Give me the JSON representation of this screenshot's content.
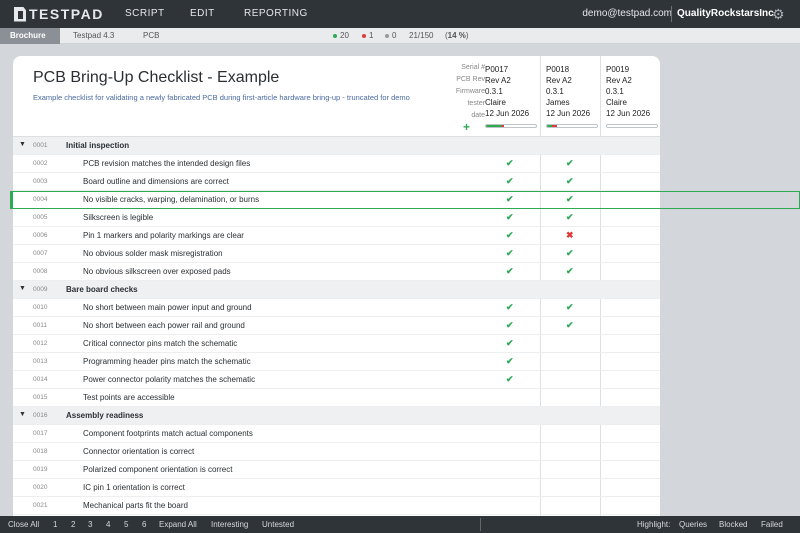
{
  "app": {
    "name": "TESTPAD"
  },
  "nav": {
    "script": "SCRIPT",
    "edit": "EDIT",
    "reporting": "REPORTING"
  },
  "account": {
    "email": "demo@testpad.com",
    "org": "QualityRockstarsInc"
  },
  "breadcrumbs": [
    "Brochure",
    "Testpad 4.3",
    "PCB"
  ],
  "stats": {
    "pass": "20",
    "fail": "1",
    "blocked": "0",
    "progress": "21/150",
    "percent_open": "(",
    "percent": "14 %",
    "percent_close": ")"
  },
  "colors": {
    "pass": "#2eaa55",
    "fail": "#e03a3a",
    "blocked": "#999999",
    "accent": "#2eaa55"
  },
  "script": {
    "title": "PCB Bring-Up Checklist - Example",
    "description": "Example checklist for validating a newly fabricated PCB during first-article hardware bring-up - truncated for demo"
  },
  "header_labels": [
    "Serial #",
    "PCB Rev",
    "Firmware",
    "tester",
    "date"
  ],
  "runs": [
    {
      "serial": "P0017",
      "rev": "Rev A2",
      "firmware": "0.3.1",
      "tester": "Claire",
      "date": "12 Jun 2026",
      "progress": 0.35
    },
    {
      "serial": "P0018",
      "rev": "Rev A2",
      "firmware": "0.3.1",
      "tester": "James",
      "date": "12 Jun 2026",
      "progress": 0.2
    },
    {
      "serial": "P0019",
      "rev": "Rev A2",
      "firmware": "0.3.1",
      "tester": "Claire",
      "date": "12 Jun 2026",
      "progress": 0
    }
  ],
  "rows": [
    {
      "num": "0001",
      "text": "Initial inspection",
      "section": true,
      "results": [
        "",
        "",
        ""
      ]
    },
    {
      "num": "0002",
      "text": "PCB revision matches the intended design files",
      "results": [
        "pass",
        "pass",
        ""
      ]
    },
    {
      "num": "0003",
      "text": "Board outline and dimensions are correct",
      "results": [
        "pass",
        "pass",
        ""
      ]
    },
    {
      "num": "0004",
      "text": "No visible cracks, warping, delamination, or burns",
      "results": [
        "pass",
        "pass",
        ""
      ]
    },
    {
      "num": "0005",
      "text": "Silkscreen is legible",
      "results": [
        "pass",
        "pass",
        ""
      ]
    },
    {
      "num": "0006",
      "text": "Pin 1 markers and polarity markings are clear",
      "results": [
        "pass",
        "fail",
        ""
      ]
    },
    {
      "num": "0007",
      "text": "No obvious solder mask misregistration",
      "results": [
        "pass",
        "pass",
        ""
      ]
    },
    {
      "num": "0008",
      "text": "No obvious silkscreen over exposed pads",
      "results": [
        "pass",
        "pass",
        ""
      ]
    },
    {
      "num": "0009",
      "text": "Bare board checks",
      "section": true,
      "results": [
        "",
        "",
        ""
      ]
    },
    {
      "num": "0010",
      "text": "No short between main power input and ground",
      "results": [
        "pass",
        "pass",
        ""
      ]
    },
    {
      "num": "0011",
      "text": "No short between each power rail and ground",
      "results": [
        "pass",
        "pass",
        ""
      ]
    },
    {
      "num": "0012",
      "text": "Critical connector pins match the schematic",
      "results": [
        "pass",
        "",
        ""
      ]
    },
    {
      "num": "0013",
      "text": "Programming header pins match the schematic",
      "results": [
        "pass",
        "",
        ""
      ]
    },
    {
      "num": "0014",
      "text": "Power connector polarity matches the schematic",
      "results": [
        "pass",
        "",
        ""
      ]
    },
    {
      "num": "0015",
      "text": "Test points are accessible",
      "results": [
        "",
        "",
        ""
      ]
    },
    {
      "num": "0016",
      "text": "Assembly readiness",
      "section": true,
      "results": [
        "",
        "",
        ""
      ]
    },
    {
      "num": "0017",
      "text": "Component footprints match actual components",
      "results": [
        "",
        "",
        ""
      ]
    },
    {
      "num": "0018",
      "text": "Connector orientation is correct",
      "results": [
        "",
        "",
        ""
      ]
    },
    {
      "num": "0019",
      "text": "Polarized component orientation is correct",
      "results": [
        "",
        "",
        ""
      ]
    },
    {
      "num": "0020",
      "text": "IC pin 1 orientation is correct",
      "results": [
        "",
        "",
        ""
      ]
    },
    {
      "num": "0021",
      "text": "Mechanical parts fit the board",
      "results": [
        "",
        "",
        ""
      ]
    }
  ],
  "footer": {
    "close_all": "Close All",
    "levels": [
      "1",
      "2",
      "3",
      "4",
      "5",
      "6"
    ],
    "expand_all": "Expand All",
    "interesting": "Interesting",
    "untested": "Untested",
    "highlight": "Highlight:",
    "queries": "Queries",
    "blocked": "Blocked",
    "failed": "Failed"
  },
  "icons": {
    "pass": "check-icon",
    "fail": "cross-icon",
    "collapse": "triangle-down-icon",
    "settings": "gear-icon",
    "add": "plus-icon"
  }
}
